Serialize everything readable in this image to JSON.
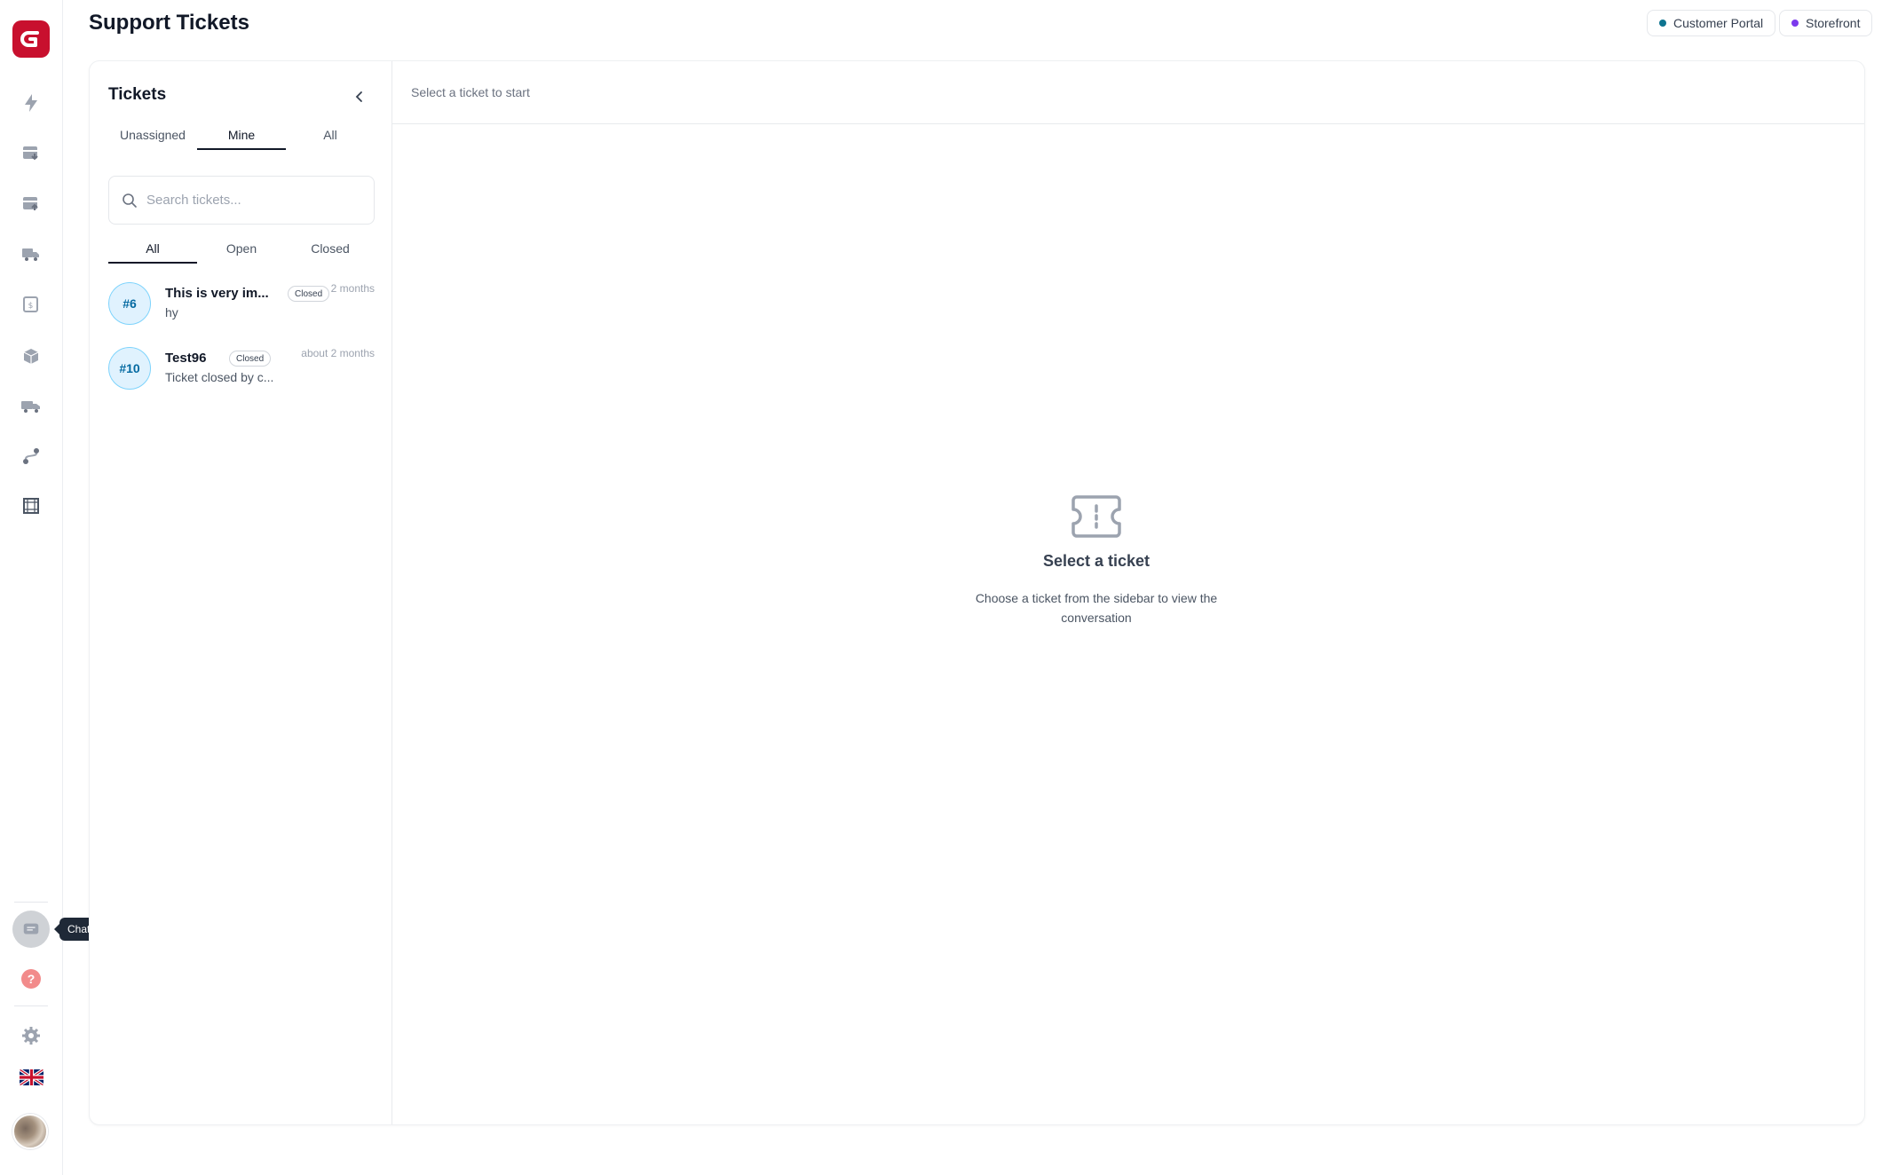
{
  "header": {
    "title": "Support Tickets",
    "links": [
      {
        "label": "Customer Portal",
        "dot_color": "#0e7490"
      },
      {
        "label": "Storefront",
        "dot_color": "#7c3aed"
      }
    ]
  },
  "rail": {
    "icons": [
      "bolt-icon",
      "box-in-icon",
      "box-out-icon",
      "truck-box-icon",
      "invoice-icon",
      "boxes-icon",
      "delivery-truck-icon",
      "route-icon",
      "frame-icon"
    ],
    "chat_tooltip": "Chat",
    "help_glyph": "?"
  },
  "sidebar": {
    "title": "Tickets",
    "assign_tabs": [
      "Unassigned",
      "Mine",
      "All"
    ],
    "active_assign_tab": "Mine",
    "search_placeholder": "Search tickets...",
    "status_tabs": [
      "All",
      "Open",
      "Closed"
    ],
    "active_status_tab": "All",
    "tickets": [
      {
        "number": "#6",
        "name": "This is very im...",
        "status": "Closed",
        "time": "2 months",
        "preview": "hy"
      },
      {
        "number": "#10",
        "name": "Test96",
        "status": "Closed",
        "time": "about 2 months",
        "preview": "Ticket closed by c..."
      }
    ]
  },
  "detail": {
    "header_hint": "Select a ticket to start",
    "empty_title": "Select a ticket",
    "empty_description": "Choose a ticket from the sidebar to view the conversation"
  }
}
